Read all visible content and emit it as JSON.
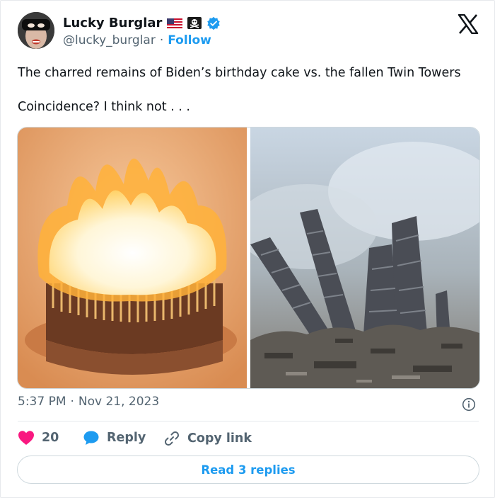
{
  "author": {
    "display_name": "Lucky Burglar",
    "handle": "@lucky_burglar",
    "separator": "·",
    "follow_label": "Follow",
    "badges": [
      "us-flag-icon",
      "skull-crossbones-icon",
      "verified-badge-icon"
    ]
  },
  "brand": {
    "logo": "x-logo-icon"
  },
  "tweet": {
    "text_line1": "The charred remains of Biden’s birthday cake vs. the fallen Twin Towers",
    "text_line2": "Coincidence?  I think not . . ."
  },
  "media": [
    {
      "name": "burning-birthday-cake-photo"
    },
    {
      "name": "twin-towers-ruins-photo"
    }
  ],
  "meta": {
    "time": "5:37 PM",
    "separator": "·",
    "date": "Nov 21, 2023"
  },
  "actions": {
    "like_count": "20",
    "reply_label": "Reply",
    "copy_link_label": "Copy link"
  },
  "read_replies_label": "Read 3 replies",
  "colors": {
    "accent": "#1d9bf0",
    "like": "#f91880",
    "text": "#0f1419",
    "secondary": "#536471"
  }
}
